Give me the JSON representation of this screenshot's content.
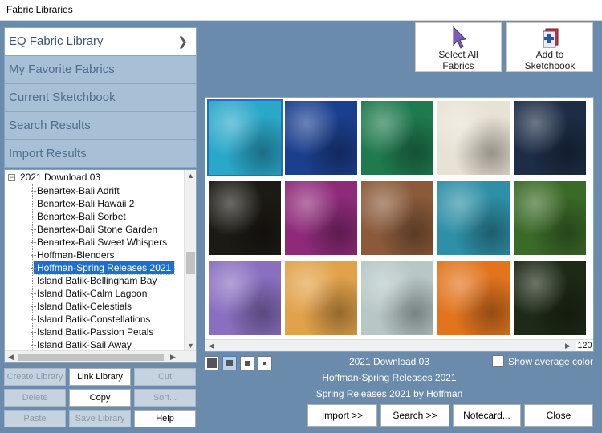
{
  "window": {
    "title": "Fabric Libraries"
  },
  "nav": {
    "items": [
      {
        "label": "EQ Fabric Library",
        "active": true
      },
      {
        "label": "My Favorite Fabrics"
      },
      {
        "label": "Current Sketchbook"
      },
      {
        "label": "Search Results"
      },
      {
        "label": "Import Results"
      }
    ]
  },
  "tree": {
    "root": "2021 Download 03",
    "items": [
      "Benartex-Bali Adrift",
      "Benartex-Bali Hawaii 2",
      "Benartex-Bali Sorbet",
      "Benartex-Bali Stone Garden",
      "Benartex-Bali Sweet Whispers",
      "Hoffman-Blenders",
      "Hoffman-Spring Releases 2021",
      "Island Batik-Bellingham Bay",
      "Island Batik-Calm Lagoon",
      "Island Batik-Celestials",
      "Island Batik-Constellations",
      "Island Batik-Passion Petals",
      "Island Batik-Sail Away"
    ],
    "selected": "Hoffman-Spring Releases 2021"
  },
  "library_buttons": {
    "create": "Create Library",
    "link": "Link Library",
    "cut": "Cut",
    "delete": "Delete",
    "copy": "Copy",
    "sort": "Sort...",
    "paste": "Paste",
    "save": "Save Library",
    "help": "Help"
  },
  "top_actions": {
    "select_all": "Select All\nFabrics",
    "add_sketchbook": "Add to\nSketchbook"
  },
  "grid": {
    "count": "120",
    "swatch_colors": [
      [
        "#2aa8c9",
        "#1b3f8f",
        "#1f7a4e",
        "#e8e2d4",
        "#1d2d46"
      ],
      [
        "#1c1a14",
        "#8f2a7a",
        "#8a5a3a",
        "#2e8fa6",
        "#3a6a28"
      ],
      [
        "#8a6fc0",
        "#e2a24a",
        "#b7c7c6",
        "#e2741e",
        "#1e2a16"
      ]
    ]
  },
  "info": {
    "library": "2021 Download 03",
    "collection": "Hoffman-Spring Releases 2021",
    "detail": "Spring Releases 2021 by Hoffman"
  },
  "show_average": {
    "label": "Show average color",
    "checked": false
  },
  "bottom_buttons": {
    "import": "Import   >>",
    "search": "Search   >>",
    "notecard": "Notecard...",
    "close": "Close"
  }
}
